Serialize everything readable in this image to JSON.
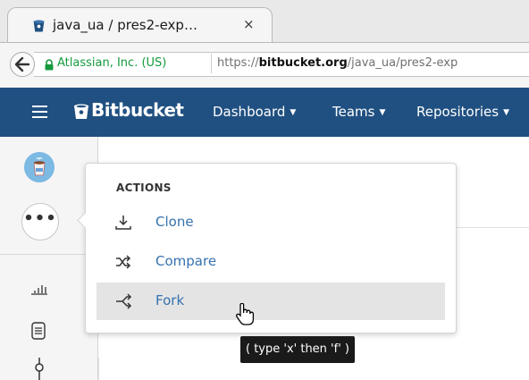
{
  "browser": {
    "tab_title": "java_ua / pres2-exp…",
    "tab_close": "×",
    "org": "Atlassian, Inc. (US)",
    "url_prefix": "https://",
    "url_domain": "bitbucket.org",
    "url_path": "/java_ua/pres2-exp"
  },
  "header": {
    "logo": "Bitbucket",
    "nav": [
      "Dashboard",
      "Teams",
      "Repositories"
    ],
    "caret": "▼"
  },
  "sidebar": {
    "more_label": "•••"
  },
  "popup": {
    "heading": "ACTIONS",
    "actions": [
      {
        "label": "Clone",
        "icon": "download-icon"
      },
      {
        "label": "Compare",
        "icon": "shuffle-icon"
      },
      {
        "label": "Fork",
        "icon": "fork-icon"
      }
    ],
    "tooltip": "( type 'x' then 'f' )"
  },
  "colors": {
    "header_bg": "#205081",
    "link": "#3572b0",
    "secure": "#149a3d"
  }
}
